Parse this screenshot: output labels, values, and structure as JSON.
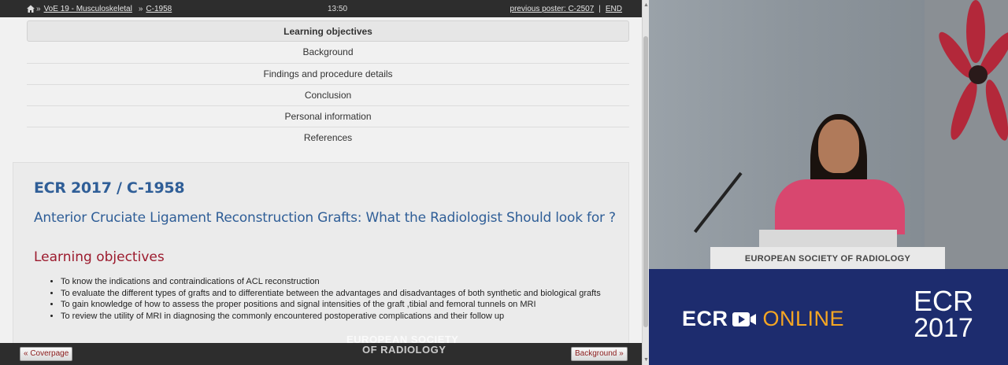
{
  "topbar": {
    "crumb_1": "VoE 19 - Musculoskeletal",
    "crumb_2": "C-1958",
    "time": "13:50",
    "prev_poster": "previous poster: C-2507",
    "separator": "|",
    "end": "END"
  },
  "toc": {
    "items": [
      "Learning objectives",
      "Background",
      "Findings and procedure details",
      "Conclusion",
      "Personal information",
      "References"
    ]
  },
  "card": {
    "id": "ECR 2017 / C-1958",
    "title": "Anterior Cruciate Ligament Reconstruction Grafts: What the Radiologist Should look for ?",
    "section": "Learning objectives",
    "objectives": [
      "To know the indications and contraindications of ACL reconstruction",
      "To evaluate the different types of grafts and to differentiate between the advantages and disadvantages of both synthetic and biological grafts",
      "To gain knowledge of how to assess the proper positions and signal intensities of the graft ,tibial and femoral tunnels on MRI",
      "To review the utility of MRI in diagnosing the commonly encountered postoperative complications and their follow up"
    ]
  },
  "watermark": {
    "line1": "EUROPEAN SOCIETY",
    "line2": "OF RADIOLOGY"
  },
  "nav": {
    "prev": "« Coverpage",
    "next": "Background »"
  },
  "video": {
    "podium_sign": "EUROPEAN SOCIETY OF RADIOLOGY",
    "brand_ecr": "ECR",
    "brand_online": "ONLINE",
    "logo_ecr": "ECR",
    "logo_year": "2017"
  },
  "colors": {
    "title_blue": "#2f5e97",
    "section_red": "#9c1b2e",
    "banner_navy": "#1d2c6e",
    "online_orange": "#f5a623"
  }
}
